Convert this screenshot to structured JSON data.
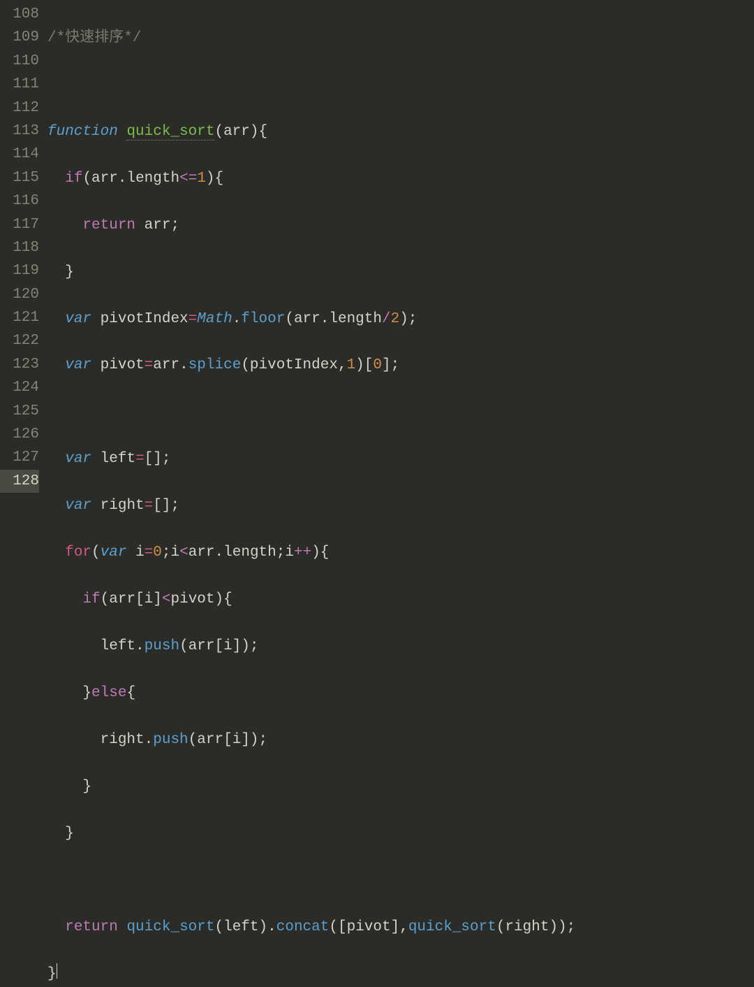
{
  "editor": {
    "theme": "dark",
    "firstLine": 108,
    "lastLine": 128,
    "activeLine": 128,
    "lineNumbers": [
      "108",
      "109",
      "110",
      "111",
      "112",
      "113",
      "114",
      "115",
      "116",
      "117",
      "118",
      "119",
      "120",
      "121",
      "122",
      "123",
      "124",
      "125",
      "126",
      "127",
      "128"
    ],
    "tokens": {
      "comment_quicksort": "/*快速排序*/",
      "kw_function": "function",
      "fn_quick_sort": "quick_sort",
      "id_arr": "arr",
      "kw_if": "if",
      "prop_length": "length",
      "op_lte": "<=",
      "num_1": "1",
      "kw_return": "return",
      "kw_var": "var",
      "id_pivotIndex": "pivotIndex",
      "cls_Math": "Math",
      "fn_floor": "floor",
      "op_div": "/",
      "num_2": "2",
      "id_pivot": "pivot",
      "fn_splice": "splice",
      "num_0": "0",
      "id_left": "left",
      "id_right": "right",
      "kw_for": "for",
      "id_i": "i",
      "op_lt": "<",
      "op_inc": "++",
      "fn_push": "push",
      "kw_else": "else",
      "fn_concat": "concat",
      "eq": "="
    }
  }
}
